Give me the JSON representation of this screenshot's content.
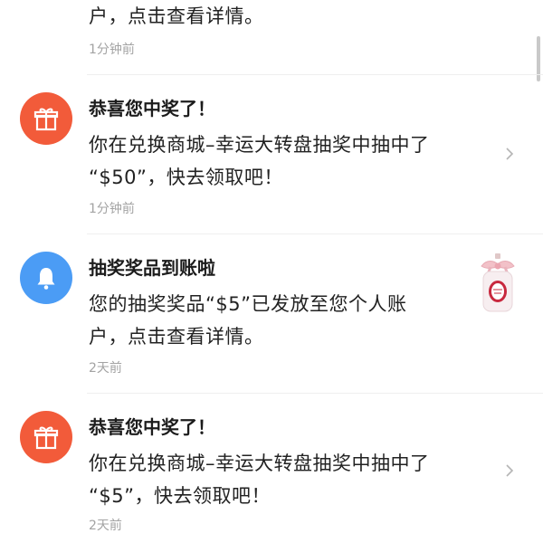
{
  "notifications": [
    {
      "body_lines": [
        "户，点击查看详情。"
      ],
      "time": "1分钟前"
    },
    {
      "icon": "gift-icon",
      "icon_color": "#f25b3a",
      "title": "恭喜您中奖了！",
      "body_lines": [
        "你在兑换商城–幸运大转盘抽奖中抽中了",
        "“$50”，快去领取吧！"
      ],
      "time": "1分钟前"
    },
    {
      "icon": "bell-icon",
      "icon_color": "#4b9cf5",
      "title": "抽奖奖品到账啦",
      "body_lines": [
        "您的抽奖奖品“$5”已发放至您个人账",
        "户，点击查看详情。"
      ],
      "time": "2天前"
    },
    {
      "icon": "gift-icon",
      "icon_color": "#f25b3a",
      "title": "恭喜您中奖了！",
      "body_lines": [
        "你在兑换商城–幸运大转盘抽奖中抽中了",
        "“$5”，快去领取吧！"
      ],
      "time": "2天前"
    }
  ]
}
